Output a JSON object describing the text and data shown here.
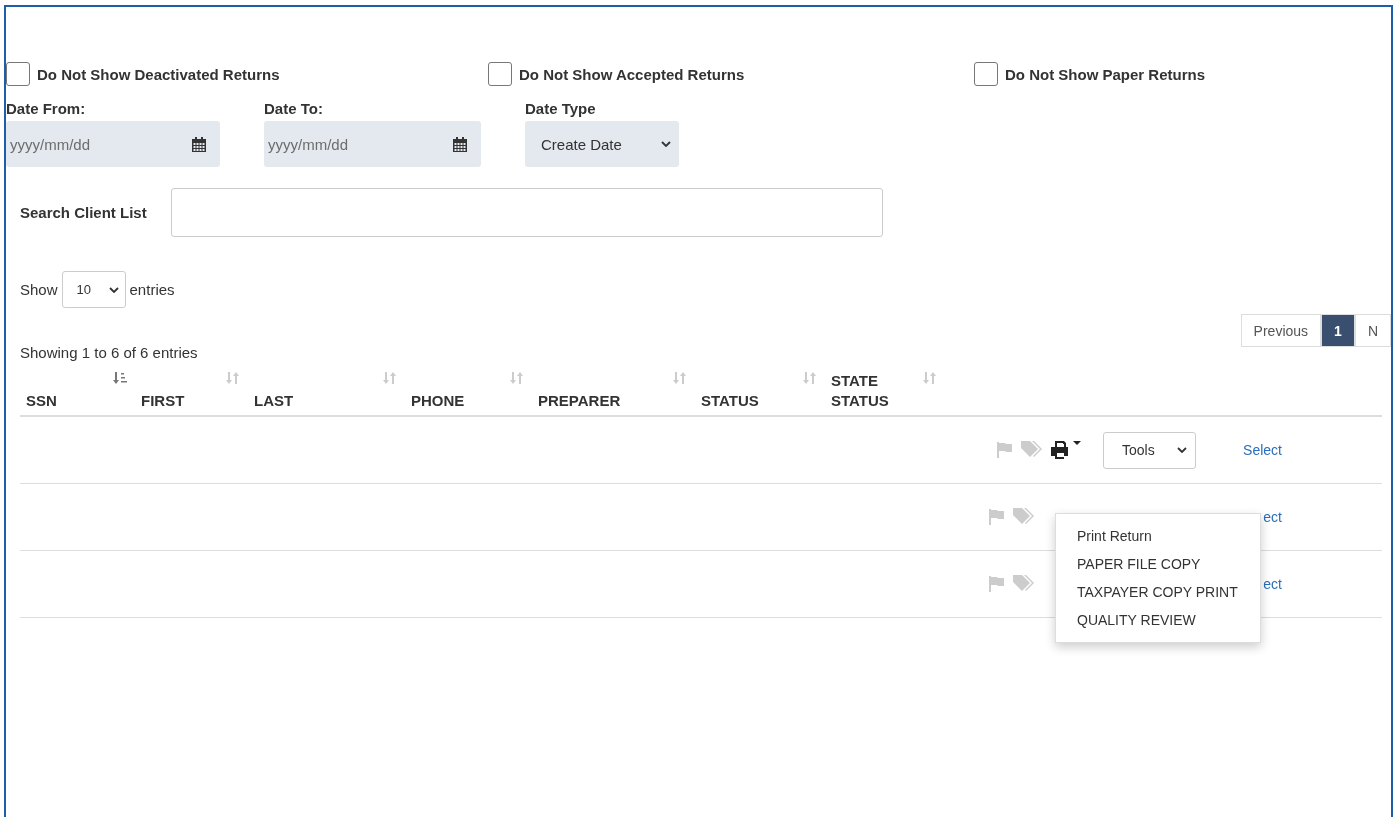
{
  "filters": [
    {
      "label": "Do Not Show Deactivated Returns",
      "checked": false
    },
    {
      "label": "Do Not Show Accepted Returns",
      "checked": false
    },
    {
      "label": "Do Not Show Paper Returns",
      "checked": false
    }
  ],
  "date_from": {
    "label": "Date From:",
    "placeholder": "yyyy/mm/dd"
  },
  "date_to": {
    "label": "Date To:",
    "placeholder": "yyyy/mm/dd"
  },
  "date_type": {
    "label": "Date Type",
    "value": "Create Date"
  },
  "search": {
    "label": "Search Client List"
  },
  "page_length": {
    "before": "Show",
    "value": "10",
    "after": "entries"
  },
  "pagination": [
    {
      "label": "Previous",
      "selected": false
    },
    {
      "label": "1",
      "selected": true
    },
    {
      "label": "N",
      "selected": false
    }
  ],
  "info": "Showing 1 to 6 of 6 entries",
  "columns": [
    {
      "label": "SSN",
      "sorted": true
    },
    {
      "label": "FIRST",
      "sorted": false
    },
    {
      "label": "LAST",
      "sorted": false
    },
    {
      "label": "PHONE",
      "sorted": false
    },
    {
      "label": "PREPARER",
      "sorted": false
    },
    {
      "label": "STATUS",
      "sorted": false
    },
    {
      "label": "STATE STATUS",
      "sorted": false
    }
  ],
  "rows": [
    {
      "kind": "full",
      "tools": "Tools",
      "link": "Select"
    },
    {
      "kind": "covered",
      "link": "ect"
    },
    {
      "kind": "covered",
      "link": "ect"
    }
  ],
  "print_menu": [
    "Print Return",
    "PAPER FILE COPY",
    "TAXPAYER COPY PRINT",
    "QUALITY REVIEW"
  ]
}
